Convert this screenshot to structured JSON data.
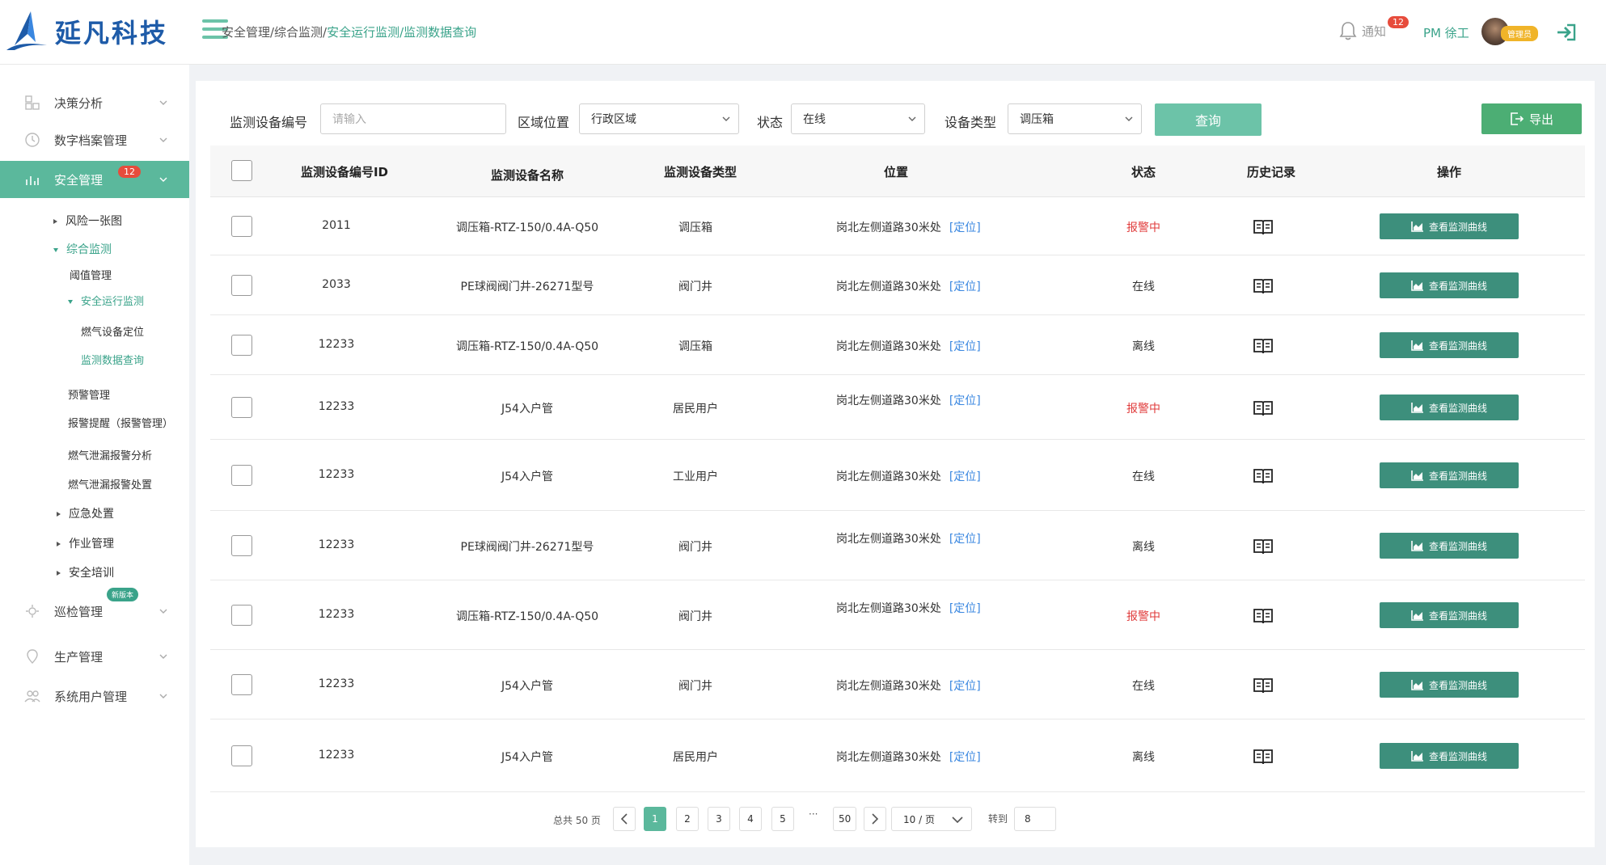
{
  "brand": {
    "name": "延凡科技"
  },
  "breadcrumb": {
    "part1": "安全管理/综合监测/",
    "part2": "安全运行监测/监测数据查询"
  },
  "header": {
    "notify_label": "通知",
    "notify_count": "12",
    "user": "PM 徐工",
    "role": "管理员"
  },
  "sidebar": {
    "items": [
      {
        "label": "决策分析"
      },
      {
        "label": "数字档案管理"
      },
      {
        "label": "安全管理",
        "badge": "12"
      },
      {
        "label": "巡检管理",
        "badge": "新版本"
      },
      {
        "label": "生产管理"
      },
      {
        "label": "系统用户管理"
      }
    ],
    "sub": {
      "risk_map": "风险一张图",
      "monitor": "综合监测",
      "threshold": "阈值管理",
      "safety_run": "安全运行监测",
      "gas_locate": "燃气设备定位",
      "data_query": "监测数据查询",
      "warning_mgmt": "预警管理",
      "alarm_notice": "报警提醒（报警管理）",
      "leak_analysis": "燃气泄漏报警分析",
      "leak_handle": "燃气泄漏报警处置",
      "emergency": "应急处置",
      "work_mgmt": "作业管理",
      "safety_train": "安全培训"
    }
  },
  "filters": {
    "device_id_label": "监测设备编号",
    "device_id_placeholder": "请输入",
    "area_label": "区域位置",
    "area_value": "行政区域",
    "status_label": "状态",
    "status_value": "在线",
    "type_label": "设备类型",
    "type_value": "调压箱",
    "query_label": "查询",
    "export_label": "导出"
  },
  "table": {
    "headers": [
      "监测设备编号ID",
      "监测设备名称",
      "监测设备类型",
      "位置",
      "状态",
      "历史记录",
      "操作"
    ],
    "loc_link": "[定位]",
    "action_label": "查看监测曲线",
    "rows": [
      {
        "id": "2011",
        "name": "调压箱-RTZ-150/0.4A-Q50",
        "type": "调压箱",
        "loc": "岗北左侧道路30米处",
        "status": "报警中",
        "alarm": true
      },
      {
        "id": "2033",
        "name": "PE球阀阀门井-26271型号",
        "type": "阀门井",
        "loc": "岗北左侧道路30米处",
        "status": "在线",
        "alarm": false
      },
      {
        "id": "12233",
        "name": "调压箱-RTZ-150/0.4A-Q50",
        "type": "调压箱",
        "loc": "岗北左侧道路30米处",
        "status": "离线",
        "alarm": false
      },
      {
        "id": "12233",
        "name": "J54入户管",
        "type": "居民用户",
        "loc": "岗北左侧道路30米处",
        "status": "报警中",
        "alarm": true
      },
      {
        "id": "12233",
        "name": "J54入户管",
        "type": "工业用户",
        "loc": "岗北左侧道路30米处",
        "status": "在线",
        "alarm": false
      },
      {
        "id": "12233",
        "name": "PE球阀阀门井-26271型号",
        "type": "阀门井",
        "loc": "岗北左侧道路30米处",
        "status": "离线",
        "alarm": false
      },
      {
        "id": "12233",
        "name": "调压箱-RTZ-150/0.4A-Q50",
        "type": "阀门井",
        "loc": "岗北左侧道路30米处",
        "status": "报警中",
        "alarm": true
      },
      {
        "id": "12233",
        "name": "J54入户管",
        "type": "阀门井",
        "loc": "岗北左侧道路30米处",
        "status": "在线",
        "alarm": false
      },
      {
        "id": "12233",
        "name": "J54入户管",
        "type": "居民用户",
        "loc": "岗北左侧道路30米处",
        "status": "离线",
        "alarm": false
      }
    ]
  },
  "pagination": {
    "total": "总共 50 页",
    "pages": [
      "1",
      "2",
      "3",
      "4",
      "5",
      "50"
    ],
    "current": "1",
    "ellipsis": "···",
    "page_size": "10 / 页",
    "goto_label": "转到",
    "goto_value": "8"
  },
  "colors": {
    "accent": "#5bb89c",
    "alarm": "#e03c3c",
    "link": "#3a87e0",
    "action": "#3d8f7c"
  }
}
